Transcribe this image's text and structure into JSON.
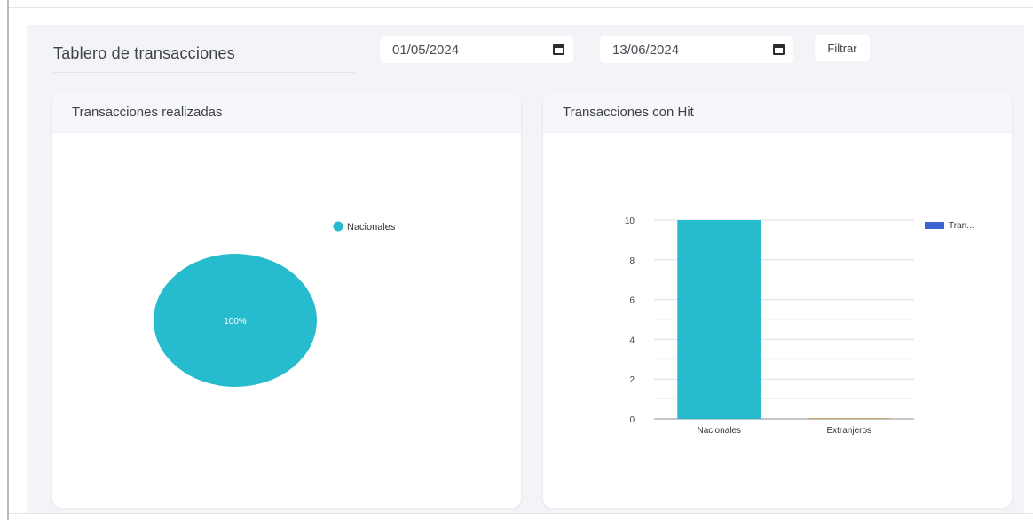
{
  "header": {
    "title": "Tablero de transacciones",
    "date_from": "01/05/2024",
    "date_to": "13/06/2024",
    "filter_label": "Filtrar"
  },
  "cards": {
    "left_title": "Transacciones realizadas",
    "right_title": "Transacciones con Hit"
  },
  "colors": {
    "teal": "#26bccd",
    "legend_blue": "#3b66cf",
    "extranjeros": "#c9a86a"
  },
  "chart_data": [
    {
      "type": "pie",
      "categories": [
        "Nacionales"
      ],
      "values": [
        100
      ],
      "slice_labels": [
        "100%"
      ],
      "legend": [
        "Nacionales"
      ],
      "legend_position": "right"
    },
    {
      "type": "bar",
      "categories": [
        "Nacionales",
        "Extranjeros"
      ],
      "series": [
        {
          "name": "Tran...",
          "values": [
            10,
            0
          ]
        }
      ],
      "ylim": [
        0,
        10
      ],
      "yticks": [
        0,
        2,
        4,
        6,
        8,
        10
      ],
      "grid": true,
      "legend_position": "top-right"
    }
  ]
}
